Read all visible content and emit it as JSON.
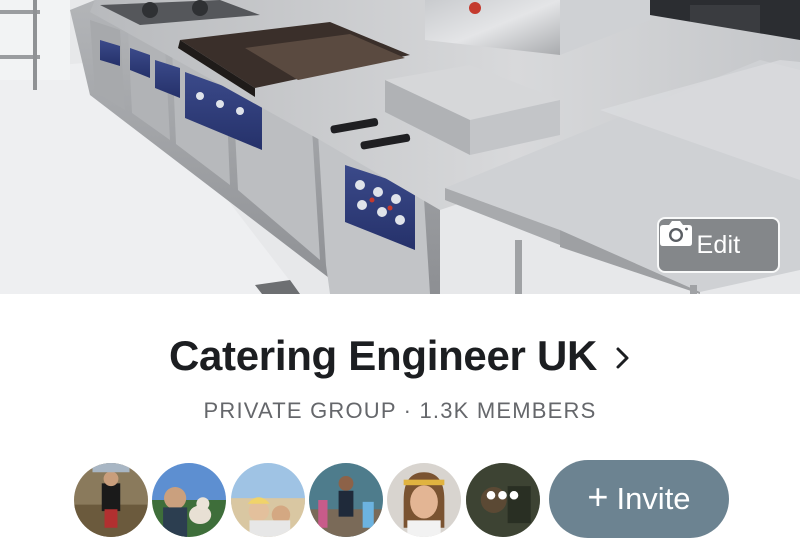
{
  "group": {
    "name": "Catering Engineer UK",
    "meta": "PRIVATE GROUP · 1.3K MEMBERS"
  },
  "cover": {
    "edit_label": "Edit",
    "edit_icon": "camera-icon"
  },
  "members": {
    "avatars": [
      {
        "name": "member-avatar-1"
      },
      {
        "name": "member-avatar-2"
      },
      {
        "name": "member-avatar-3"
      },
      {
        "name": "member-avatar-4"
      },
      {
        "name": "member-avatar-5"
      },
      {
        "name": "member-avatar-6"
      }
    ],
    "more_label": "•••",
    "invite_label": "Invite",
    "invite_icon": "plus-icon"
  },
  "colors": {
    "invite_bg": "#6c8391",
    "title_text": "#1c1e21",
    "meta_text": "#65676b"
  }
}
